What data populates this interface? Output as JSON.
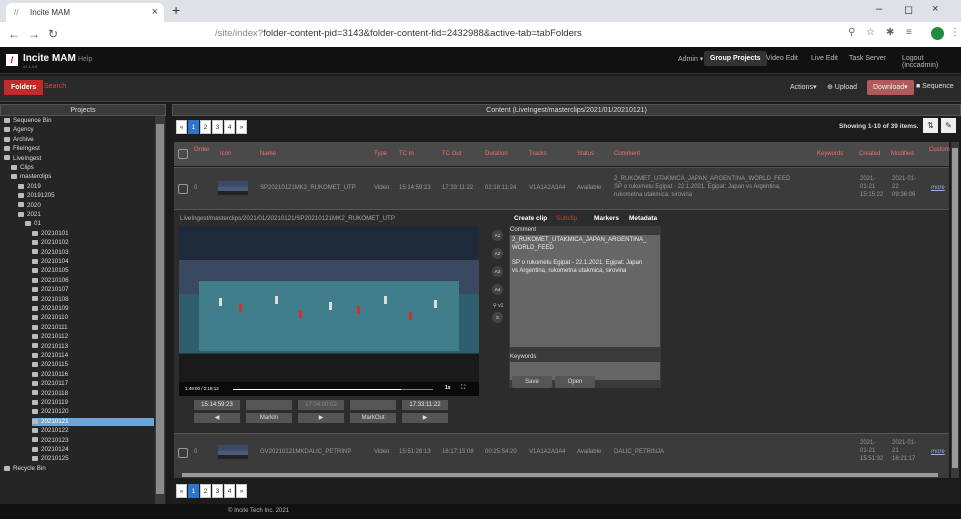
{
  "browser": {
    "tab_title": "Incite MAM",
    "url_dim": "/site/index?",
    "url_rest": "folder-content-pid=3143&folder-content-fid=2432988&active-tab=tabFolders"
  },
  "app": {
    "name": "Incite MAM",
    "version": "v2.1.4.0",
    "help": "Help",
    "nav": [
      "Admin ▾",
      "Group Projects",
      "Video Edit",
      "Live Edit",
      "Task Server",
      "Logout (inccadmin)"
    ]
  },
  "subbar": {
    "folders": "Folders",
    "search": "Search",
    "actions": "Actions▾",
    "upload": "⊕ Upload",
    "download": "Download▾",
    "sequence": "■ Sequence"
  },
  "projects": {
    "header": "Projects",
    "tree": [
      {
        "label": "Sequence Bin",
        "indent": 0
      },
      {
        "label": "Agency",
        "indent": 0
      },
      {
        "label": "Archive",
        "indent": 0
      },
      {
        "label": "FileIngest",
        "indent": 0
      },
      {
        "label": "LiveIngest",
        "indent": 0
      },
      {
        "label": "Clips",
        "indent": 1
      },
      {
        "label": "masterclips",
        "indent": 1
      },
      {
        "label": "2019",
        "indent": 2
      },
      {
        "label": "20191205",
        "indent": 2
      },
      {
        "label": "2020",
        "indent": 2
      },
      {
        "label": "2021",
        "indent": 2
      },
      {
        "label": "01",
        "indent": 3
      },
      {
        "label": "20210101",
        "indent": 4
      },
      {
        "label": "20210102",
        "indent": 4
      },
      {
        "label": "20210103",
        "indent": 4
      },
      {
        "label": "20210104",
        "indent": 4
      },
      {
        "label": "20210105",
        "indent": 4
      },
      {
        "label": "20210106",
        "indent": 4
      },
      {
        "label": "20210107",
        "indent": 4
      },
      {
        "label": "20210108",
        "indent": 4
      },
      {
        "label": "20210109",
        "indent": 4
      },
      {
        "label": "20210110",
        "indent": 4
      },
      {
        "label": "20210111",
        "indent": 4
      },
      {
        "label": "20210112",
        "indent": 4
      },
      {
        "label": "20210113",
        "indent": 4
      },
      {
        "label": "20210114",
        "indent": 4
      },
      {
        "label": "20210115",
        "indent": 4
      },
      {
        "label": "20210116",
        "indent": 4
      },
      {
        "label": "20210117",
        "indent": 4
      },
      {
        "label": "20210118",
        "indent": 4
      },
      {
        "label": "20210119",
        "indent": 4
      },
      {
        "label": "20210120",
        "indent": 4
      },
      {
        "label": "20210121",
        "indent": 4,
        "selected": true
      },
      {
        "label": "20210122",
        "indent": 4
      },
      {
        "label": "20210123",
        "indent": 4
      },
      {
        "label": "20210124",
        "indent": 4
      },
      {
        "label": "20210125",
        "indent": 4
      },
      {
        "label": "Recycle Bin",
        "indent": 0
      }
    ]
  },
  "content": {
    "header": "Content (LiveIngest/masterclips/2021/01/20210121)",
    "pages": [
      "«",
      "1",
      "2",
      "3",
      "4",
      "»"
    ],
    "showing": "Showing 1-10 of 39 items.",
    "columns": [
      "Order",
      "Icon",
      "Name",
      "Type",
      "TC In",
      "TC Out",
      "Duration",
      "Tracks",
      "Status",
      "Comment",
      "Keywords",
      "Created",
      "Modified",
      "Custom"
    ],
    "rows": [
      {
        "order": "0",
        "name": "SP20210121MK2_RUKOMET_UTP",
        "type": "Video",
        "tc_in": "15:14:59:23",
        "tc_out": "17:33:11:22",
        "duration": "02:18:11:24",
        "tracks": "V1A1A2A3A4",
        "status": "Available",
        "comment_1": "2_RUKOMET_UTAKMICA_JAPAN_ARGENTINA_WORLD_FEED",
        "comment_2": "SP o rukometu Egipat - 22.1.2021. Egipat: Japan vs Argentina,",
        "comment_3": "rukometna utakmica, sirovina",
        "created_1": "2021-",
        "created_2": "01-21",
        "created_3": "15:15:22",
        "modified_1": "2021-01-",
        "modified_2": "22",
        "modified_3": "09:36:06",
        "custom": "more"
      },
      {
        "order": "0",
        "name": "GV20210121MKDALIC_PETRINP",
        "type": "Video",
        "tc_in": "15:51:26:13",
        "tc_out": "16:17:15:08",
        "duration": "00:25:54:20",
        "tracks": "V1A1A2A3A4",
        "status": "Available",
        "comment_1": "DALIC_PETRINJA",
        "created_1": "2021-",
        "created_2": "01-21",
        "created_3": "15:51:32",
        "modified_1": "2021-01-",
        "modified_2": "21",
        "modified_3": "16:21:17",
        "custom": "more"
      }
    ]
  },
  "editor": {
    "path": "LiveIngest/masterclips/2021/01/20210121/SP20210121MK2_RUKOMET_UTP",
    "tabs": {
      "create_clip": "Create clip",
      "subclip": "Subclip",
      "markers": "Markers",
      "metadata": "Metadata"
    },
    "video_time": "1:49:00  /  2:18:12",
    "speed": "1x",
    "audio_tracks": [
      "A1",
      "A2",
      "A3",
      "A4"
    ],
    "channel": "v1",
    "channel_s": "S",
    "comment_label": "Comment",
    "comment_line1": "2_RUKOMET_UTAKMICA_JAPAN_ARGENTINA_",
    "comment_line2": "WORLD_FEED",
    "comment_line3": "SP o rukometu Egipat - 22.1.2021. Egipat: Japan",
    "comment_line4": "vs Argentina, rukometna utakmica, sirovina",
    "keywords_label": "Keywords",
    "save": "Save",
    "open": "Open",
    "tc_start": "15:14:59:23",
    "tc_mark": "17:04:00:02",
    "tc_end": "17:33:11:22",
    "buttons": [
      "◀",
      "MarkIn",
      "▶",
      "MarkOut",
      "▶"
    ]
  },
  "footer": "© Incite Tech Inc. 2021"
}
